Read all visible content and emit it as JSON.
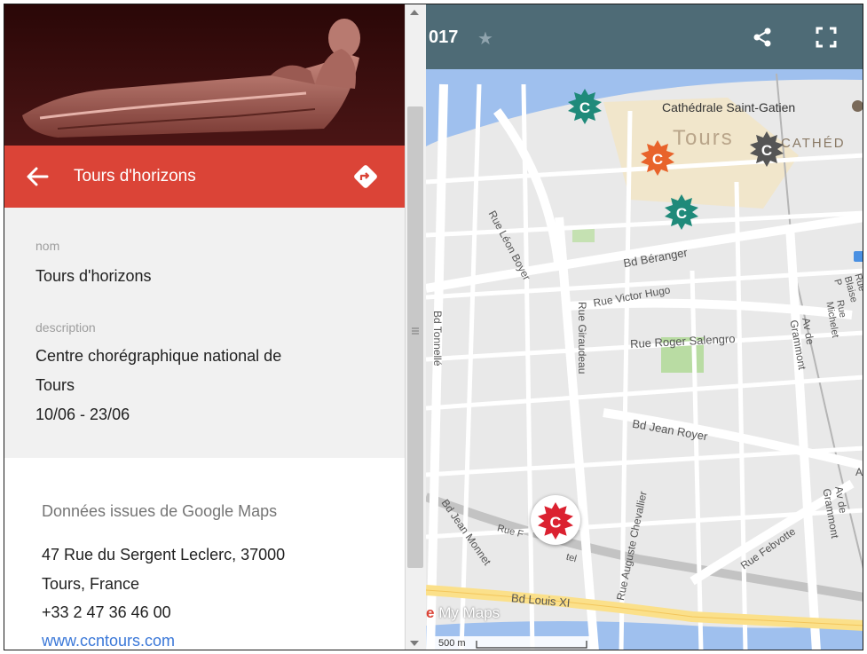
{
  "place": {
    "title": "Tours d'horizons",
    "name_label": "nom",
    "name_value": "Tours d'horizons",
    "description_label": "description",
    "description_lines": [
      "Centre chorégraphique national de",
      "Tours",
      "10/06 - 23/06"
    ]
  },
  "google_maps": {
    "heading": "Données issues de Google Maps",
    "address_lines": [
      "47 Rue du Sergent Leclerc, 37000",
      "Tours, France"
    ],
    "phone": "+33 2 47 36 46 00",
    "website": "www.ccntours.com"
  },
  "map": {
    "title_fragment": "017",
    "scale_label": "500 m",
    "brand_label": "My Maps",
    "labels": {
      "cathedral": "Cathédrale Saint-Gatien",
      "city": "Tours",
      "district": "CATHÉD",
      "leon_boyer": "Rue Léon Boyer",
      "beranger": "Bd Béranger",
      "victor_hugo": "Rue Victor Hugo",
      "tonnelle": "Bd Tonnellé",
      "giraudeau": "Rue Giraudeau",
      "salengro": "Rue Roger Salengro",
      "grammont": "Av de Grammont",
      "michelet": "Rue Michelet",
      "blaise": "Rue Blaise P",
      "jean_royer": "Bd Jean Royer",
      "jean_monnet": "Bd Jean Monnet",
      "rue_hotel": "Rue F",
      "hotel_suffix": "tel",
      "chevallier": "Rue Auguste Chevallier",
      "febvotte": "Rue Febvotte",
      "louis_xi": "Bd Louis XI",
      "grammont2": "Av de Grammont",
      "av_short": "A"
    },
    "markers": [
      {
        "name": "marker-teal-1",
        "color": "#1f8a7a"
      },
      {
        "name": "marker-orange",
        "color": "#e8632b"
      },
      {
        "name": "marker-gray",
        "color": "#555555"
      },
      {
        "name": "marker-teal-2",
        "color": "#1f8a7a"
      },
      {
        "name": "marker-red-selected",
        "color": "#db2130"
      }
    ]
  },
  "colors": {
    "accent_red": "#db4437",
    "map_header": "#4e6b76",
    "link": "#3b78d8"
  }
}
